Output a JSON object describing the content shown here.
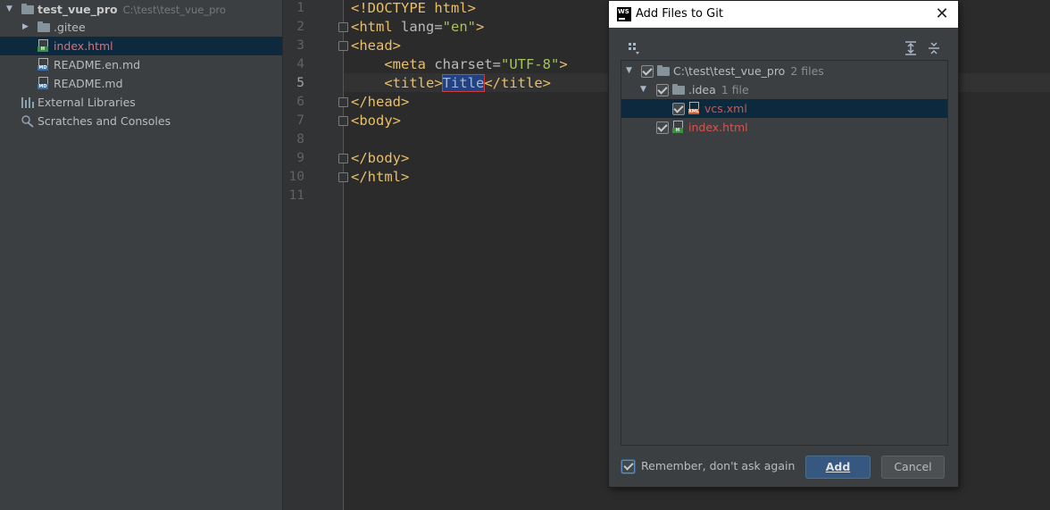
{
  "project": {
    "root": {
      "name": "test_vue_pro",
      "path": "C:\\test\\test_vue_pro"
    },
    "items": [
      {
        "label": ".gitee",
        "icon": "folder-icon"
      },
      {
        "label": "index.html",
        "icon": "html-file-icon"
      },
      {
        "label": "README.en.md",
        "icon": "markdown-file-icon"
      },
      {
        "label": "README.md",
        "icon": "markdown-file-icon"
      }
    ],
    "external_libraries": "External Libraries",
    "scratches": "Scratches and Consoles"
  },
  "editor": {
    "line_numbers": [
      "1",
      "2",
      "3",
      "4",
      "5",
      "6",
      "7",
      "8",
      "9",
      "10",
      "11"
    ],
    "current_line": 5,
    "lines": {
      "l1": "<!DOCTYPE html>",
      "l2_open": "<html ",
      "l2_attr": "lang=",
      "l2_val": "\"en\"",
      "l2_close": ">",
      "l3": "<head>",
      "l4_open": "    <meta ",
      "l4_attr": "charset=",
      "l4_val": "\"UTF-8\"",
      "l4_close": ">",
      "l5_open": "    <title>",
      "l5_text": "Title",
      "l5_close": "</title>",
      "l6": "</head>",
      "l7": "<body>",
      "l9": "</body>",
      "l10": "</html>"
    }
  },
  "dialog": {
    "title": "Add Files to Git",
    "close_glyph": "✕",
    "tree": {
      "root": {
        "label": "C:\\test\\test_vue_pro",
        "count": "2 files"
      },
      "idea": {
        "label": ".idea",
        "count": "1 file"
      },
      "vcs": {
        "label": "vcs.xml"
      },
      "index": {
        "label": "index.html"
      }
    },
    "remember_label": "Remember, don't ask again",
    "add_label": "Add",
    "cancel_label": "Cancel"
  }
}
